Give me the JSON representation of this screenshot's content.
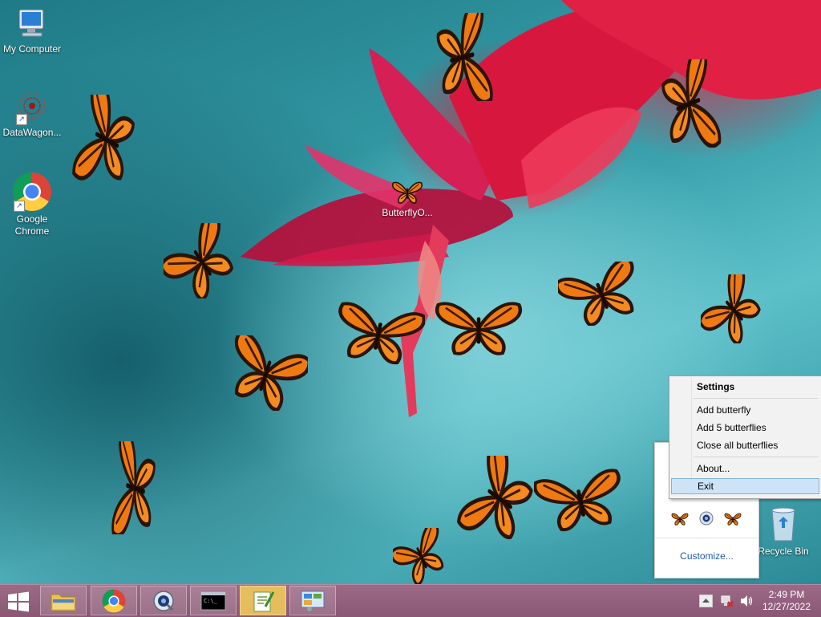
{
  "desktop": {
    "icons": [
      {
        "label": "My Computer"
      },
      {
        "label": "DataWagon..."
      },
      {
        "label": "Google Chrome"
      },
      {
        "label": "ButterflyO..."
      },
      {
        "label": "Recycle Bin"
      }
    ]
  },
  "context_menu": {
    "items": [
      {
        "label": "Settings"
      },
      {
        "label": "Add butterfly"
      },
      {
        "label": "Add 5 butterflies"
      },
      {
        "label": "Close all butterflies"
      },
      {
        "label": "About..."
      },
      {
        "label": "Exit"
      }
    ]
  },
  "tray_flyout": {
    "customize_label": "Customize..."
  },
  "taskbar": {
    "clock_time": "2:49 PM",
    "clock_date": "12/27/2022",
    "buttons": [
      {
        "name": "file-explorer"
      },
      {
        "name": "google-chrome"
      },
      {
        "name": "quicktime"
      },
      {
        "name": "command-prompt"
      },
      {
        "name": "notepad-plus-plus"
      },
      {
        "name": "control-panel"
      }
    ]
  },
  "colors": {
    "taskbar": "#8a5774",
    "menu_highlight": "#cde4f7",
    "link": "#1e5aa8",
    "butterfly_orange": "#f07a12"
  }
}
